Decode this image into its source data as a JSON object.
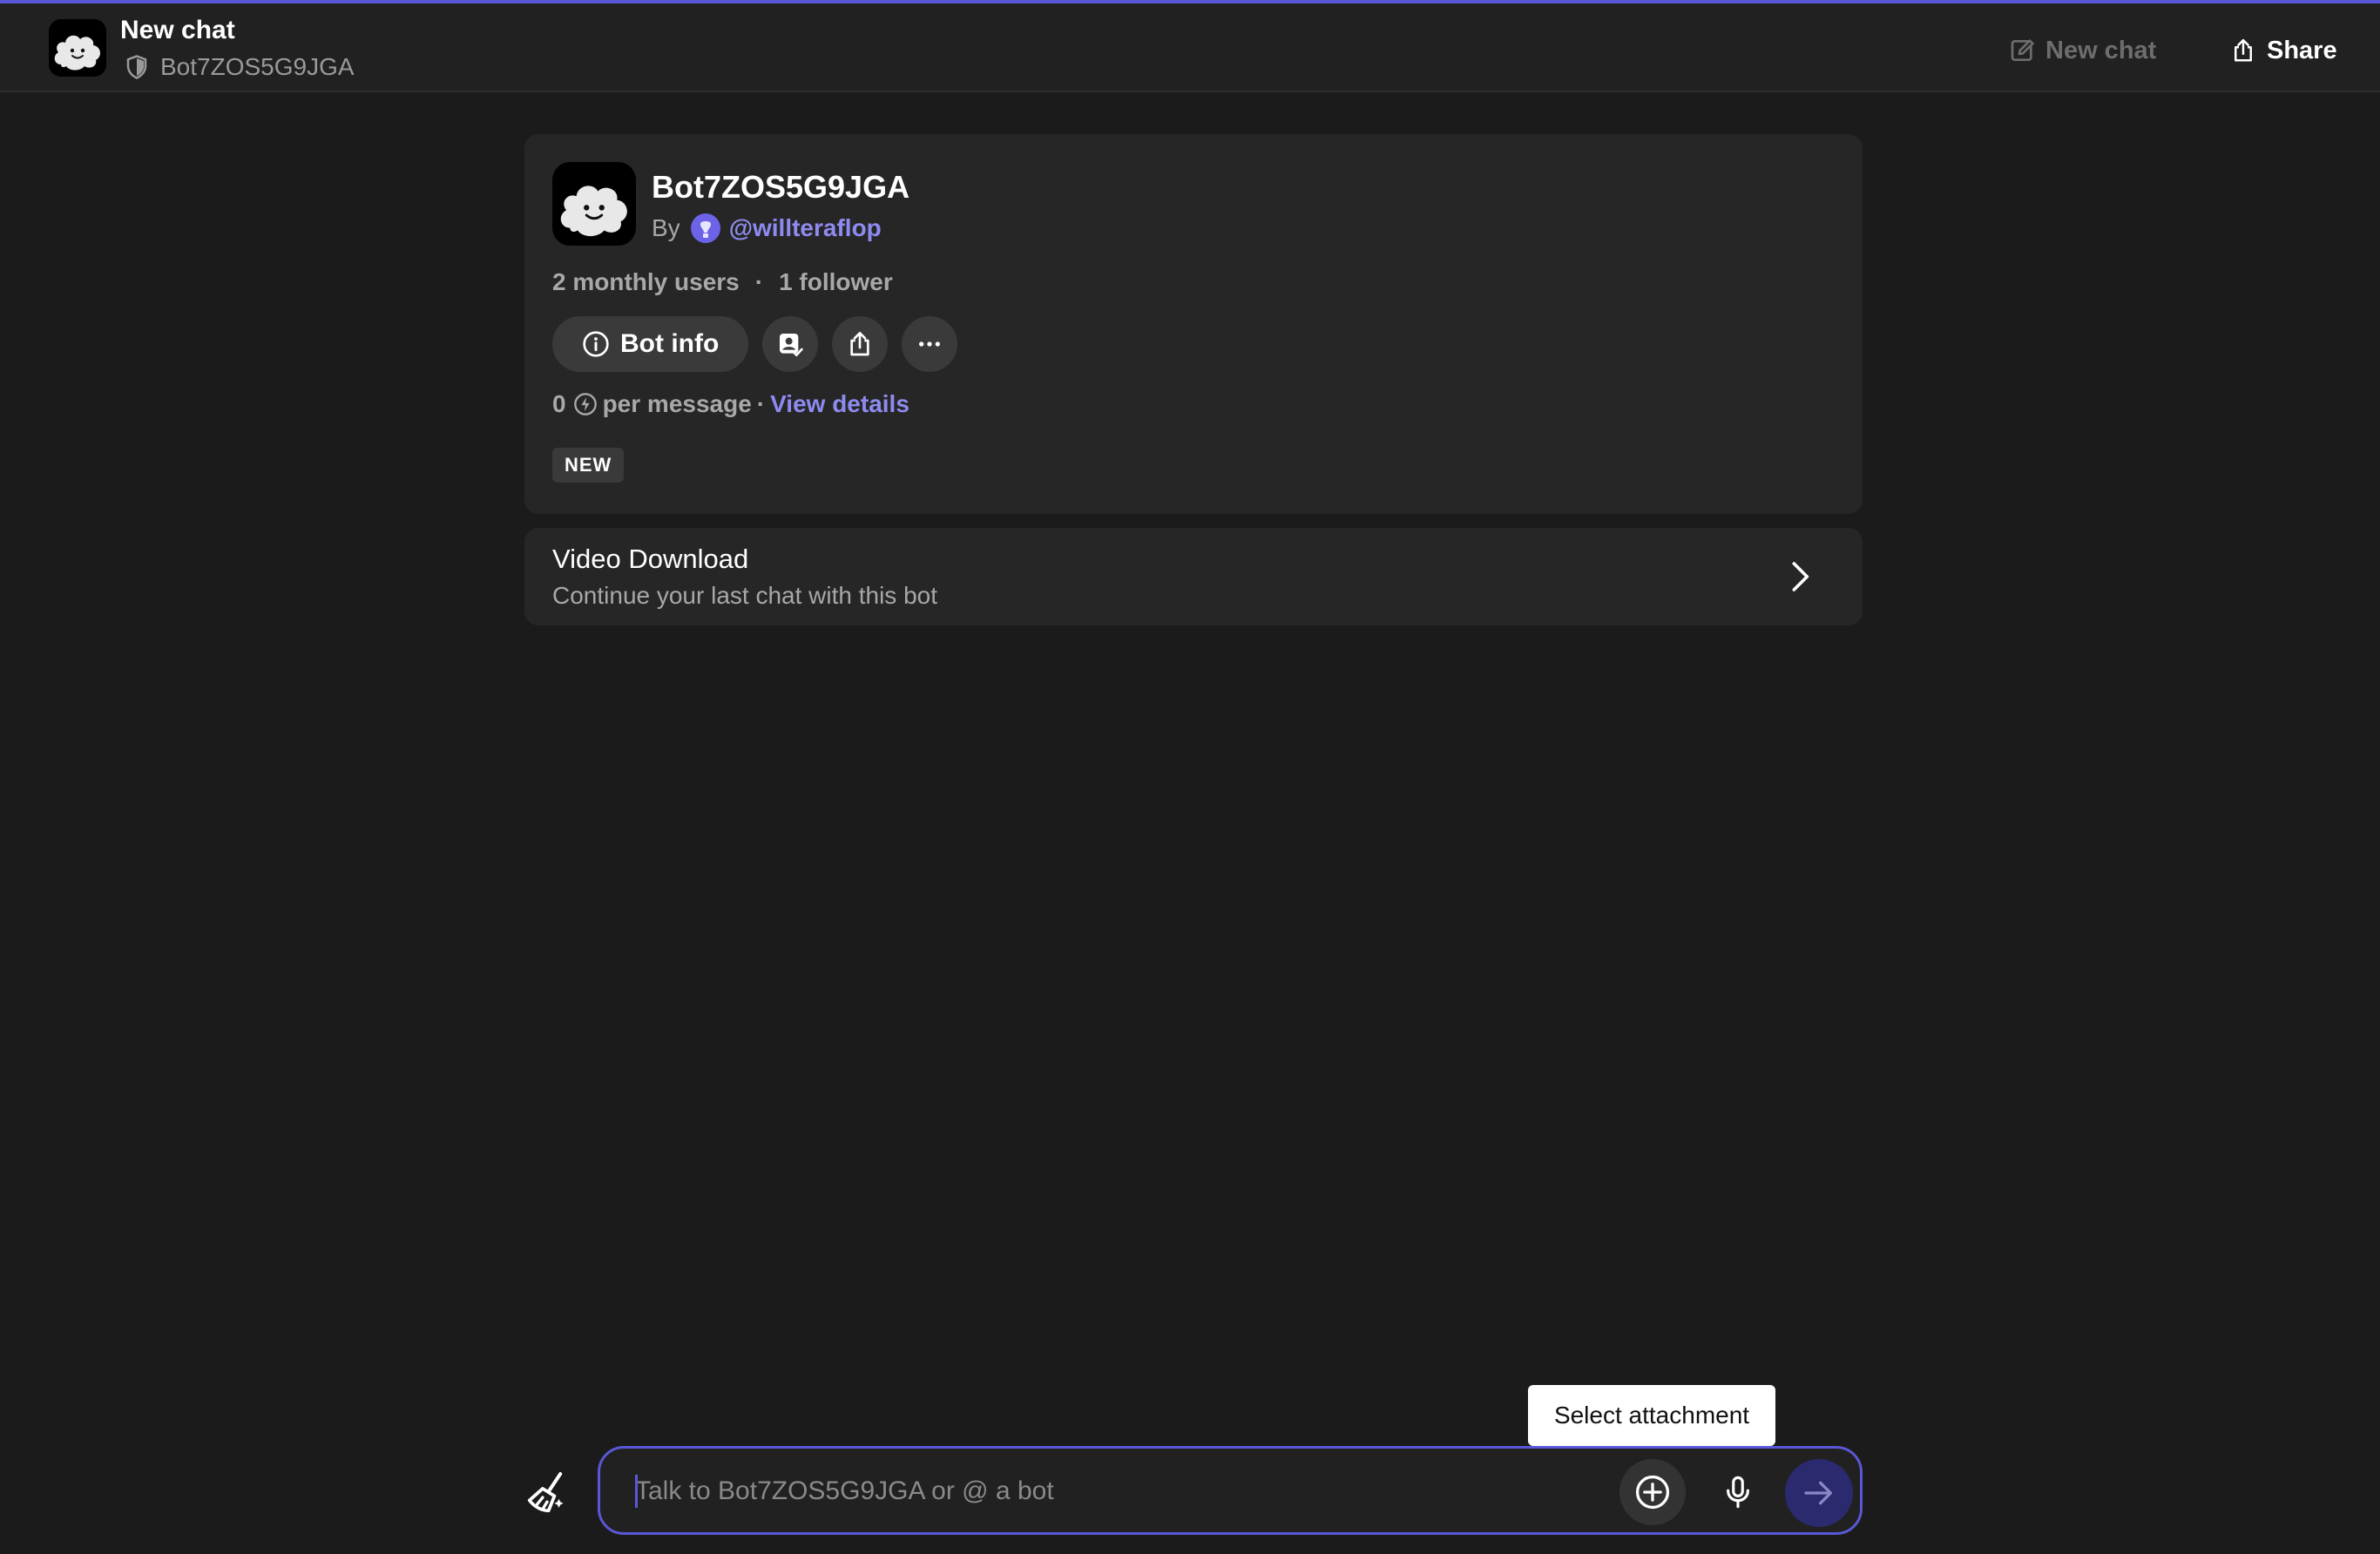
{
  "header": {
    "title": "New chat",
    "bot_name": "Bot7ZOS5G9JGA",
    "new_chat_label": "New chat",
    "share_label": "Share"
  },
  "bot_card": {
    "name": "Bot7ZOS5G9JGA",
    "by_label": "By",
    "creator": "@willteraflop",
    "monthly_users": "2 monthly users",
    "stats_separator": "·",
    "followers": "1 follower",
    "bot_info_label": "Bot info",
    "price_value": "0",
    "price_suffix": "per message",
    "price_separator": "·",
    "view_details_label": "View details",
    "badge": "NEW"
  },
  "previous_chat": {
    "title": "Video Download",
    "subtitle": "Continue your last chat with this bot"
  },
  "composer": {
    "placeholder": "Talk to Bot7ZOS5G9JGA or @ a bot",
    "value": ""
  },
  "tooltip": {
    "text": "Select attachment"
  },
  "icons": {
    "avatar": "cloud-face-avatar-icon",
    "shield": "shield-icon",
    "new_chat": "edit-icon",
    "share": "share-icon",
    "info": "info-icon",
    "add_to_profile": "profile-check-icon",
    "more": "ellipsis-icon",
    "compute_points": "bolt-icon",
    "chevron": "chevron-right-icon",
    "clear_context": "broom-icon",
    "attach": "plus-circle-icon",
    "mic": "microphone-icon",
    "send": "arrow-right-icon"
  },
  "colors": {
    "accent": "#5a57d6",
    "link": "#8e8bf0",
    "background": "#1b1b1b",
    "card": "#262626",
    "send_button": "#2c2a6e"
  }
}
